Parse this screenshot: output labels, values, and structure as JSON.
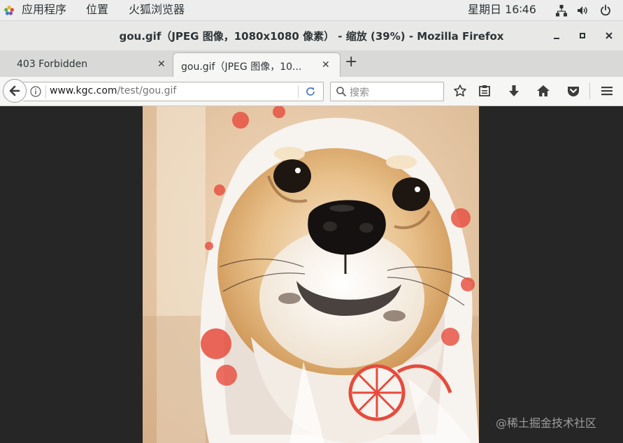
{
  "topbar": {
    "applications": "应用程序",
    "places": "位置",
    "active_app": "火狐浏览器",
    "clock": "星期日 16∶46"
  },
  "window": {
    "title": "gou.gif（JPEG 图像，1080x1080 像素） - 缩放 (39%) - Mozilla Firefox"
  },
  "tabs": [
    {
      "label": "403 Forbidden"
    },
    {
      "label": "gou.gif（JPEG 图像，10..."
    }
  ],
  "navbar": {
    "url_domain": "www.kgc.com",
    "url_path": "/test/gou.gif",
    "search_placeholder": "搜索"
  },
  "content": {
    "image_description": "shiba inu dog wearing a white hood with red citrus pattern",
    "zoom": "39%"
  },
  "watermark": "@稀土掘金技术社区",
  "colors": {
    "topbar_bg": "#ededed",
    "page_bg": "#262626",
    "hood_red": "#e64b3c"
  }
}
